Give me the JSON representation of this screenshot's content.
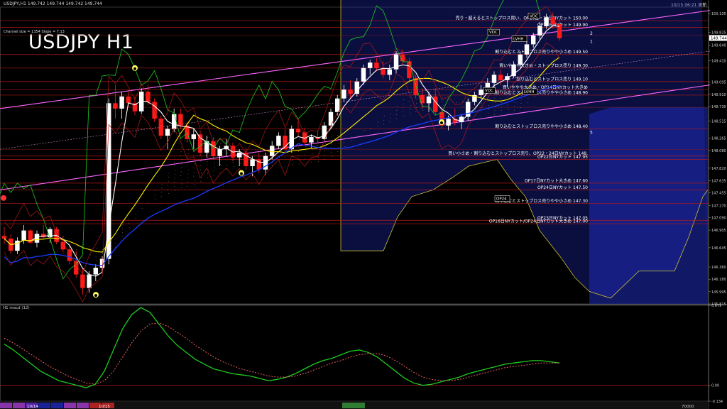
{
  "window": {
    "header_text": "USDJPY,H1  149.742 149.744 149.742 149.744",
    "datetime": "10/15 06:21 更新",
    "channel_text": "Channel size = 1354 Slope = 7.13",
    "big_title": "USDJPY H1",
    "current_price": "149.744"
  },
  "colors": {
    "bull": "#ffffff",
    "bear": "#ff1a1a",
    "ma_fast": "#ffffff",
    "ma_mid": "#ffee00",
    "ma_slow": "#1a3cff",
    "channel": "#ff66ff",
    "ichimoku_cloud": "#ffcc88",
    "forward_cloud": "#1f2bb8",
    "lagging_span": "#1ecb1e",
    "macd": "#1ecb1e",
    "signal": "#ff6b6b"
  },
  "chart_data": [
    {
      "type": "candlestick",
      "title": "USDJPY H1",
      "y_ticks": [
        "150.105",
        "149.825",
        "149.640",
        "149.410",
        "149.095",
        "148.910",
        "148.730",
        "148.515",
        "148.265",
        "148.080",
        "147.820",
        "147.635",
        "147.455",
        "147.270",
        "147.090",
        "146.905",
        "146.645",
        "146.360",
        "146.180",
        "145.995",
        "145.815"
      ],
      "ylim": [
        145.815,
        150.2
      ],
      "candles_ohlc": [
        [
          146.82,
          146.95,
          146.7,
          146.78
        ],
        [
          146.78,
          146.85,
          146.55,
          146.6
        ],
        [
          146.6,
          146.8,
          146.55,
          146.75
        ],
        [
          146.75,
          146.98,
          146.7,
          146.9
        ],
        [
          146.9,
          146.92,
          146.7,
          146.72
        ],
        [
          146.72,
          146.9,
          146.65,
          146.85
        ],
        [
          146.85,
          146.98,
          146.78,
          146.8
        ],
        [
          146.8,
          146.95,
          146.72,
          146.92
        ],
        [
          146.92,
          146.95,
          146.7,
          146.73
        ],
        [
          146.73,
          146.82,
          146.58,
          146.62
        ],
        [
          146.62,
          146.7,
          146.4,
          146.45
        ],
        [
          146.45,
          146.6,
          146.2,
          146.25
        ],
        [
          146.25,
          146.35,
          145.95,
          146.05
        ],
        [
          146.05,
          146.3,
          145.98,
          146.25
        ],
        [
          146.25,
          146.4,
          146.15,
          146.35
        ],
        [
          146.35,
          146.52,
          146.28,
          146.48
        ],
        [
          146.48,
          148.85,
          146.4,
          148.78
        ],
        [
          148.78,
          149.05,
          148.55,
          148.7
        ],
        [
          148.7,
          148.95,
          148.55,
          148.88
        ],
        [
          148.88,
          148.95,
          148.72,
          148.78
        ],
        [
          148.78,
          148.88,
          148.6,
          148.66
        ],
        [
          148.66,
          149.0,
          148.62,
          148.95
        ],
        [
          148.95,
          149.05,
          148.75,
          148.8
        ],
        [
          148.8,
          148.85,
          148.5,
          148.55
        ],
        [
          148.55,
          148.6,
          148.25,
          148.3
        ],
        [
          148.3,
          148.45,
          148.1,
          148.4
        ],
        [
          148.4,
          148.7,
          148.35,
          148.62
        ],
        [
          148.62,
          148.7,
          148.4,
          148.45
        ],
        [
          148.45,
          148.5,
          148.2,
          148.25
        ],
        [
          148.25,
          148.4,
          148.1,
          148.32
        ],
        [
          148.32,
          148.38,
          148.0,
          148.05
        ],
        [
          148.05,
          148.3,
          147.98,
          148.22
        ],
        [
          148.22,
          148.28,
          147.95,
          148.0
        ],
        [
          148.0,
          148.15,
          147.85,
          148.1
        ],
        [
          148.1,
          148.25,
          148.0,
          148.15
        ],
        [
          148.15,
          148.2,
          147.92,
          147.98
        ],
        [
          147.98,
          148.1,
          147.85,
          148.05
        ],
        [
          148.05,
          148.12,
          147.8,
          147.85
        ],
        [
          147.85,
          148.0,
          147.7,
          147.95
        ],
        [
          147.95,
          148.05,
          147.75,
          147.8
        ],
        [
          147.8,
          148.05,
          147.72,
          148.0
        ],
        [
          148.0,
          148.22,
          147.95,
          148.15
        ],
        [
          148.15,
          148.35,
          148.1,
          148.3
        ],
        [
          148.3,
          148.4,
          148.05,
          148.1
        ],
        [
          148.1,
          148.45,
          148.05,
          148.4
        ],
        [
          148.4,
          148.55,
          148.3,
          148.35
        ],
        [
          148.35,
          148.42,
          148.15,
          148.2
        ],
        [
          148.2,
          148.32,
          148.12,
          148.28
        ],
        [
          148.28,
          148.38,
          148.2,
          148.25
        ],
        [
          148.25,
          148.5,
          148.22,
          148.45
        ],
        [
          148.45,
          148.7,
          148.4,
          148.65
        ],
        [
          148.65,
          148.9,
          148.6,
          148.85
        ],
        [
          148.85,
          149.05,
          148.8,
          148.98
        ],
        [
          148.98,
          149.12,
          148.85,
          148.92
        ],
        [
          148.92,
          149.15,
          148.88,
          149.1
        ],
        [
          149.1,
          149.35,
          149.05,
          149.3
        ],
        [
          149.3,
          149.42,
          149.2,
          149.38
        ],
        [
          149.38,
          149.45,
          149.25,
          149.3
        ],
        [
          149.3,
          149.4,
          149.15,
          149.2
        ],
        [
          149.2,
          149.35,
          149.12,
          149.28
        ],
        [
          149.28,
          149.55,
          149.22,
          149.5
        ],
        [
          149.5,
          149.58,
          149.35,
          149.4
        ],
        [
          149.4,
          149.45,
          149.1,
          149.15
        ],
        [
          149.15,
          149.2,
          148.85,
          148.9
        ],
        [
          148.9,
          149.0,
          148.7,
          148.78
        ],
        [
          148.78,
          148.95,
          148.65,
          148.88
        ],
        [
          148.88,
          149.0,
          148.6,
          148.65
        ],
        [
          148.65,
          148.72,
          148.4,
          148.45
        ],
        [
          148.45,
          148.6,
          148.38,
          148.55
        ],
        [
          148.55,
          148.7,
          148.45,
          148.5
        ],
        [
          148.5,
          148.62,
          148.4,
          148.58
        ],
        [
          148.58,
          148.85,
          148.52,
          148.8
        ],
        [
          148.8,
          148.95,
          148.75,
          148.9
        ],
        [
          148.9,
          149.05,
          148.85,
          148.98
        ],
        [
          148.98,
          149.15,
          148.92,
          149.08
        ],
        [
          149.08,
          149.25,
          149.0,
          149.2
        ],
        [
          149.2,
          149.28,
          149.05,
          149.12
        ],
        [
          149.12,
          149.22,
          149.02,
          149.18
        ],
        [
          149.18,
          149.4,
          149.15,
          149.35
        ],
        [
          149.35,
          149.55,
          149.3,
          149.5
        ],
        [
          149.5,
          149.7,
          149.45,
          149.65
        ],
        [
          149.65,
          149.82,
          149.6,
          149.78
        ],
        [
          149.78,
          149.98,
          149.72,
          149.92
        ],
        [
          149.92,
          150.1,
          149.88,
          150.05
        ],
        [
          150.05,
          150.12,
          149.88,
          149.95
        ],
        [
          149.95,
          150.02,
          149.7,
          149.74
        ]
      ],
      "price_levels": [
        {
          "label": "売り・超えるとストップロス買い、OP16日・24日NYカット 150.00",
          "price": 150.0
        },
        {
          "label": "OP15日NYカット 149.90",
          "price": 149.9
        },
        {
          "label": "割り込むとストップロス売りやや小さめ 149.50",
          "price": 149.5
        },
        {
          "label": "買いややや大きめ・ストップロス売り 149.30",
          "price": 149.3
        },
        {
          "label": "割り込むとストップロス売り 149.10",
          "price": 149.1
        },
        {
          "label": "買いややや大きめ・OP14日NYカット大きめ",
          "price": 148.98
        },
        {
          "label": "割り込むとストップロス売りやや小さめ 148.90",
          "price": 148.9
        },
        {
          "label": "割り込むとストップロス売りやや小さめ 148.40",
          "price": 148.4
        },
        {
          "label": "買い小さめ・割り込むとストップロス売り、OP22・24日NYカット 148.",
          "price": 148.0
        },
        {
          "label": "OP22日NYカット 147.95",
          "price": 147.95
        },
        {
          "label": "OP17日NYカット大きめ 147.60",
          "price": 147.6
        },
        {
          "label": "OP24日NYカット 147.50",
          "price": 147.5
        },
        {
          "label": "割り込むとストップロス売りやや小さめ 147.30",
          "price": 147.3
        },
        {
          "label": "OP23日NYカット 147.05",
          "price": 147.05
        },
        {
          "label": "OP16日NYカット/OP24日NYカット大きめ 147.00",
          "price": 147.0
        }
      ],
      "box_labels": [
        "VDC",
        "LVHH",
        "VDC",
        "VDC",
        "LVHH",
        "OP24"
      ],
      "wave_labels": [
        "2",
        "1",
        "5"
      ]
    },
    {
      "type": "line",
      "title": "H1 macd (12)",
      "y_ticks": [
        "0.679",
        "0.00",
        "-0.134"
      ],
      "ylim": [
        -0.134,
        0.679
      ],
      "series": [
        {
          "values": [
            0.35,
            0.3,
            0.24,
            0.18,
            0.12,
            0.08,
            0.04,
            0.02,
            0.0,
            -0.02,
            0.01,
            0.12,
            0.3,
            0.48,
            0.6,
            0.66,
            0.62,
            0.52,
            0.42,
            0.34,
            0.28,
            0.22,
            0.18,
            0.14,
            0.12,
            0.1,
            0.09,
            0.08,
            0.06,
            0.04,
            0.05,
            0.07,
            0.1,
            0.14,
            0.18,
            0.21,
            0.23,
            0.26,
            0.29,
            0.3,
            0.28,
            0.24,
            0.18,
            0.12,
            0.06,
            0.02,
            0.0,
            0.01,
            0.03,
            0.05,
            0.07,
            0.1,
            0.12,
            0.14,
            0.16,
            0.18,
            0.19,
            0.2,
            0.21,
            0.21,
            0.2,
            0.19
          ]
        },
        {
          "values": [
            0.4,
            0.36,
            0.31,
            0.26,
            0.21,
            0.16,
            0.12,
            0.08,
            0.05,
            0.02,
            0.01,
            0.04,
            0.12,
            0.24,
            0.36,
            0.46,
            0.52,
            0.53,
            0.5,
            0.45,
            0.4,
            0.34,
            0.29,
            0.24,
            0.2,
            0.17,
            0.14,
            0.12,
            0.1,
            0.08,
            0.07,
            0.07,
            0.08,
            0.1,
            0.13,
            0.16,
            0.19,
            0.21,
            0.24,
            0.26,
            0.27,
            0.27,
            0.25,
            0.21,
            0.16,
            0.11,
            0.07,
            0.05,
            0.04,
            0.04,
            0.05,
            0.07,
            0.09,
            0.11,
            0.13,
            0.15,
            0.16,
            0.17,
            0.18,
            0.19,
            0.19,
            0.19
          ]
        }
      ]
    }
  ],
  "bottom_bar": {
    "dates": [
      "10/14",
      "10/15"
    ],
    "scroll_label": "70000"
  }
}
